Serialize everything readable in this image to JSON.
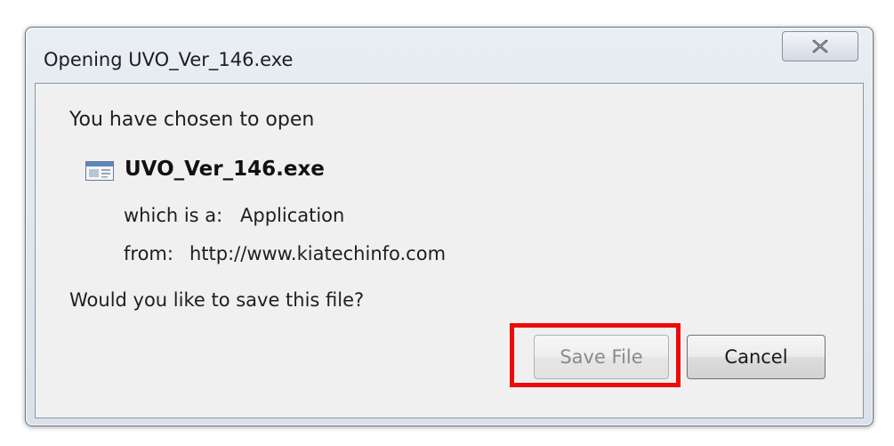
{
  "window": {
    "title": "Opening UVO_Ver_146.exe",
    "close_icon": "close-x-icon"
  },
  "content": {
    "intro": "You have chosen to open",
    "file_icon": "application-file-icon",
    "filename": "UVO_Ver_146.exe",
    "which_label": "which is a:",
    "which_value": "Application",
    "from_label": "from:",
    "from_value": "http://www.kiatechinfo.com",
    "question": "Would you like to save this file?"
  },
  "buttons": {
    "save_label": "Save File",
    "cancel_label": "Cancel"
  },
  "colors": {
    "highlight": "#ee0a0a",
    "disabled_text": "#8a8a8a"
  }
}
